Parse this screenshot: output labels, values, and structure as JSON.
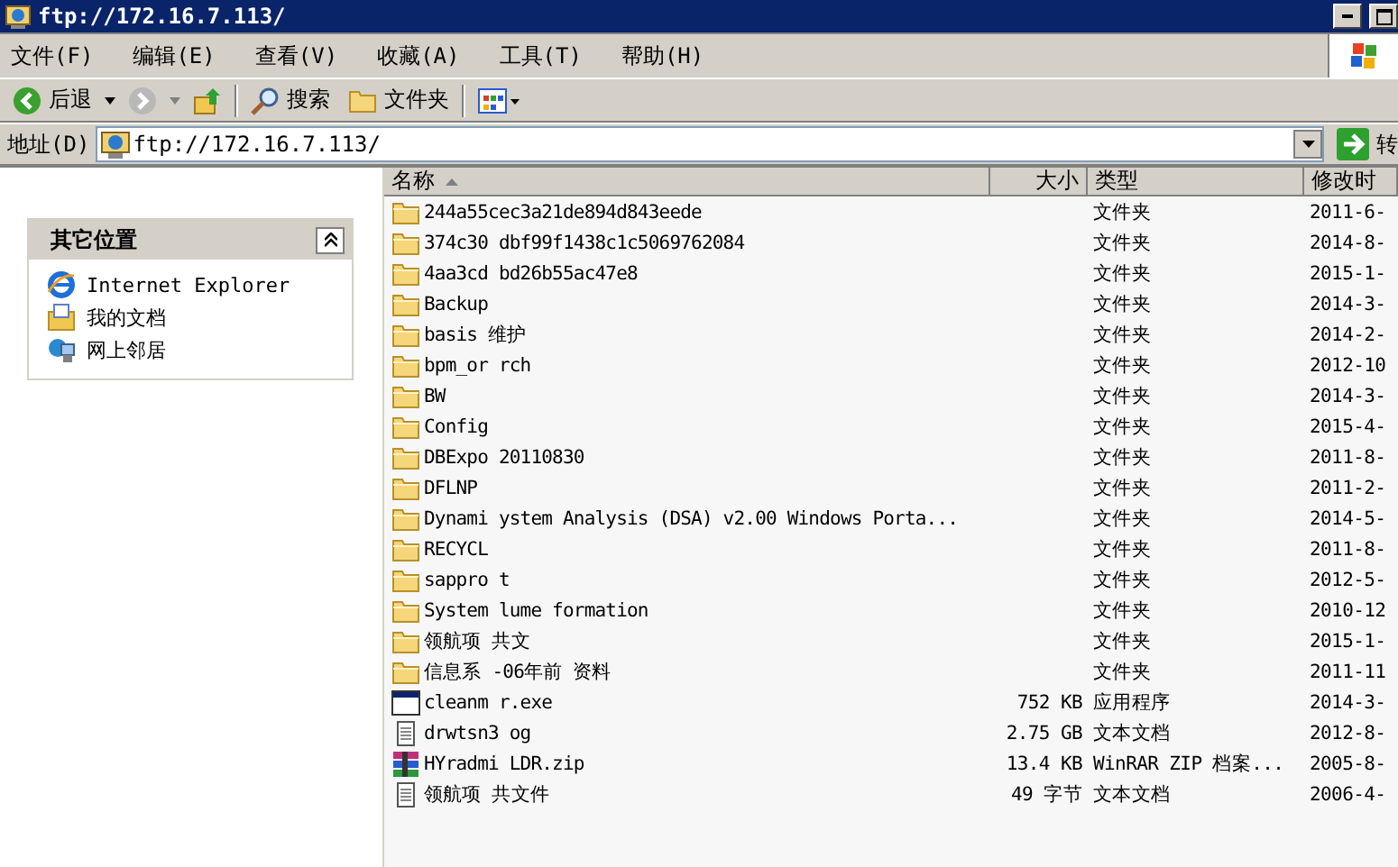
{
  "window": {
    "title": "ftp://172.16.7.113/"
  },
  "menu": [
    "文件(F)",
    "编辑(E)",
    "查看(V)",
    "收藏(A)",
    "工具(T)",
    "帮助(H)"
  ],
  "toolbar": {
    "back": "后退",
    "search": "搜索",
    "folders": "文件夹"
  },
  "address": {
    "label": "地址(D)",
    "value": "ftp://172.16.7.113/",
    "go": "转"
  },
  "sidebar": {
    "title": "其它位置",
    "items": [
      {
        "label": "Internet Explorer",
        "kind": "browser"
      },
      {
        "label": "我的文档",
        "kind": "documents"
      },
      {
        "label": "网上邻居",
        "kind": "network"
      }
    ]
  },
  "table": {
    "columns": [
      {
        "label": "名称",
        "sorted": true
      },
      {
        "label": "大小",
        "sorted": false
      },
      {
        "label": "类型",
        "sorted": false
      },
      {
        "label": "修改时",
        "sorted": false
      }
    ],
    "rows": [
      {
        "kind": "folder",
        "name": "244a55cec3a21de894d843eede",
        "size": "",
        "type": "文件夹",
        "modified": "2011-6-"
      },
      {
        "kind": "folder",
        "name": "374c30 dbf99f1438c1c5069762084",
        "size": "",
        "type": "文件夹",
        "modified": "2014-8-"
      },
      {
        "kind": "folder",
        "name": "4aa3cd bd26b55ac47e8",
        "size": "",
        "type": "文件夹",
        "modified": "2015-1-"
      },
      {
        "kind": "folder",
        "name": "Backup",
        "size": "",
        "type": "文件夹",
        "modified": "2014-3-"
      },
      {
        "kind": "folder",
        "name": "basis 维护",
        "size": "",
        "type": "文件夹",
        "modified": "2014-2-"
      },
      {
        "kind": "folder",
        "name": "bpm_or rch",
        "size": "",
        "type": "文件夹",
        "modified": "2012-10"
      },
      {
        "kind": "folder",
        "name": "BW",
        "size": "",
        "type": "文件夹",
        "modified": "2014-3-"
      },
      {
        "kind": "folder",
        "name": "Config",
        "size": "",
        "type": "文件夹",
        "modified": "2015-4-"
      },
      {
        "kind": "folder",
        "name": "DBExpo 20110830",
        "size": "",
        "type": "文件夹",
        "modified": "2011-8-"
      },
      {
        "kind": "folder",
        "name": "DFLNP",
        "size": "",
        "type": "文件夹",
        "modified": "2011-2-"
      },
      {
        "kind": "folder",
        "name": "Dynami ystem Analysis (DSA) v2.00 Windows Porta...",
        "size": "",
        "type": "文件夹",
        "modified": "2014-5-"
      },
      {
        "kind": "folder",
        "name": "RECYCL",
        "size": "",
        "type": "文件夹",
        "modified": "2011-8-"
      },
      {
        "kind": "folder",
        "name": "sappro t",
        "size": "",
        "type": "文件夹",
        "modified": "2012-5-"
      },
      {
        "kind": "folder",
        "name": "System lume formation",
        "size": "",
        "type": "文件夹",
        "modified": "2010-12"
      },
      {
        "kind": "folder",
        "name": "领航项 共文",
        "size": "",
        "type": "文件夹",
        "modified": "2015-1-"
      },
      {
        "kind": "folder",
        "name": "信息系 -06年前 资料",
        "size": "",
        "type": "文件夹",
        "modified": "2011-11"
      },
      {
        "kind": "program",
        "name": "cleanm r.exe",
        "size": "752 KB",
        "type": "应用程序",
        "modified": "2014-3-"
      },
      {
        "kind": "text",
        "name": "drwtsn3 og",
        "size": "2.75 GB",
        "type": "文本文档",
        "modified": "2012-8-"
      },
      {
        "kind": "archive",
        "name": "HYradmi LDR.zip",
        "size": "13.4 KB",
        "type": "WinRAR ZIP 档案...",
        "modified": "2005-8-"
      },
      {
        "kind": "text",
        "name": "领航项 共文件",
        "size": "49 字节",
        "type": "文本文档",
        "modified": "2006-4-"
      }
    ]
  }
}
